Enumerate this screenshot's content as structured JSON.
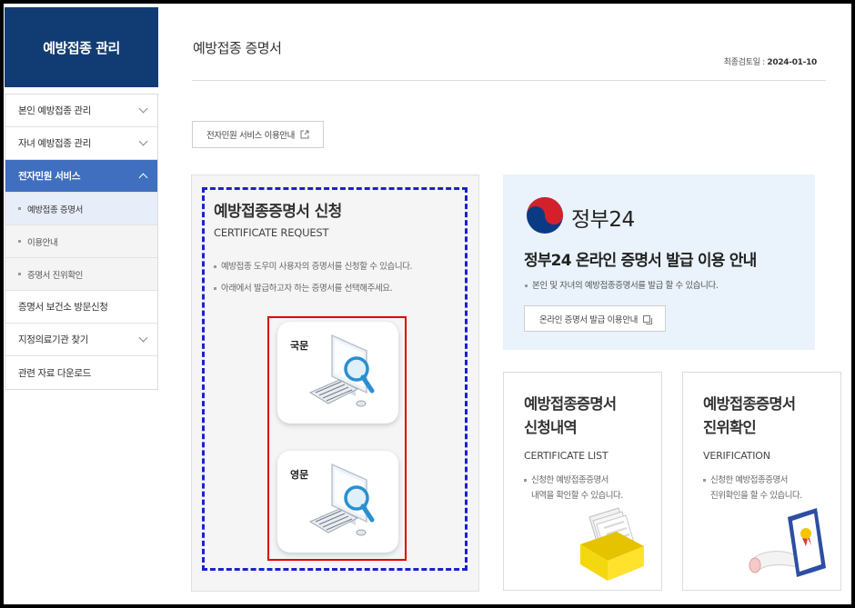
{
  "sidebar": {
    "title": "예방접종 관리",
    "items": [
      {
        "label": "본인 예방접종 관리"
      },
      {
        "label": "자녀 예방접종 관리"
      },
      {
        "label": "전자민원 서비스"
      },
      {
        "label": "증명서 보건소 방문신청"
      },
      {
        "label": "지정의료기관 찾기"
      },
      {
        "label": "관련 자료 다운로드"
      }
    ],
    "subitems": [
      {
        "label": "예방접종 증명서"
      },
      {
        "label": "이용안내"
      },
      {
        "label": "증명서 진위확인"
      }
    ]
  },
  "header": {
    "title": "예방접종 증명서",
    "review_label": "최종검토일 : ",
    "review_date": "2024-01-10"
  },
  "service_guide_label": "전자민원 서비스 이용안내",
  "apply": {
    "title": "예방접종증명서 신청",
    "subtitle": "CERTIFICATE REQUEST",
    "desc1": "예방접종 도우미 사용자의 증명서를 신청할 수 있습니다.",
    "desc2": "아래에서 발급하고자 하는 증명서를 선택해주세요.",
    "korean_label": "국문",
    "english_label": "영문"
  },
  "gov24": {
    "logo_text": "정부24",
    "heading": "정부24 온라인 증명서 발급 이용 안내",
    "desc": "본인 및 자녀의 예방접종증명서를 발급 할 수 있습니다.",
    "button_label": "온라인 증명서 발급 이용안내"
  },
  "list_card": {
    "title_line1": "예방접종증명서",
    "title_line2": "신청내역",
    "subtitle": "CERTIFICATE LIST",
    "desc_line1": "신청한 예방접종증명서",
    "desc_line2": "내역을 확인할 수 있습니다."
  },
  "verify_card": {
    "title_line1": "예방접종증명서",
    "title_line2": "진위확인",
    "subtitle": "VERIFICATION",
    "desc_line1": "신청한 예방접종증명서",
    "desc_line2": "진위확인을 할 수 있습니다."
  },
  "colors": {
    "sidebar_header": "#113c73",
    "active_menu": "#3f6fbe",
    "highlight_dashed": "#1b22c8",
    "highlight_red": "#dd0000",
    "gov24_bg": "#eaf3fb"
  }
}
